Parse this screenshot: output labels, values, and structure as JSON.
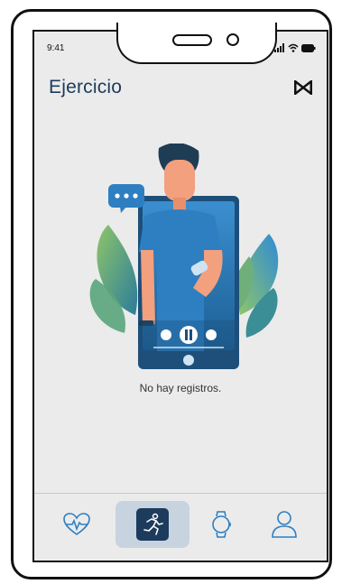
{
  "status_bar": {
    "time": "9:41",
    "icons": [
      "signal-icon",
      "wifi-icon",
      "battery-icon"
    ]
  },
  "header": {
    "title": "Ejercicio",
    "brand_icon": "bowtie-logo-icon"
  },
  "main": {
    "empty_message": "No hay registros."
  },
  "tabbar": {
    "active_index": 1,
    "tabs": [
      {
        "icon": "heart-rate-icon"
      },
      {
        "icon": "running-icon"
      },
      {
        "icon": "smartwatch-icon"
      },
      {
        "icon": "user-icon"
      }
    ]
  },
  "colors": {
    "primary": "#1d3b5c",
    "active_tab_bg": "#c8d3e0",
    "screen_bg": "#ebebeb",
    "accent_blue": "#2d7fc1"
  }
}
